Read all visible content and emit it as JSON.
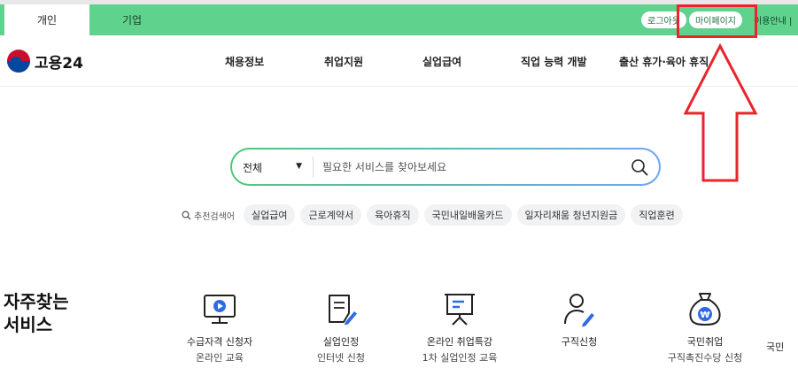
{
  "topbar": {
    "tab_personal": "개인",
    "tab_company": "기업",
    "logout": "로그아웃",
    "mypage": "마이페이지",
    "guide": "이용안내 |"
  },
  "header": {
    "logo_text": "고용24",
    "nav": [
      "채용정보",
      "취업지원",
      "실업급여",
      "직업 능력 개발",
      "출산 휴가·육아 휴직"
    ]
  },
  "search": {
    "category": "전체",
    "placeholder": "필요한 서비스를 찾아보세요"
  },
  "recommended": {
    "label": "추천검색어",
    "chips": [
      "실업급여",
      "근로계약서",
      "육아휴직",
      "국민내일배움카드",
      "일자리채움 청년지원금",
      "직업훈련"
    ]
  },
  "frequent": {
    "title_line1": "자주찾는",
    "title_line2": "서비스",
    "items": [
      {
        "line1": "수급자격 신청자",
        "line2": "온라인 교육",
        "icon": "monitor-play-icon"
      },
      {
        "line1": "실업인정",
        "line2": "인터넷 신청",
        "icon": "document-pen-icon"
      },
      {
        "line1": "온라인 취업특강",
        "line2": "1차 실업인정 교육",
        "icon": "presentation-board-icon"
      },
      {
        "line1": "구직신청",
        "line2": "",
        "icon": "person-pen-icon"
      },
      {
        "line1": "국민취업",
        "line2": "구직촉진수당 신청",
        "icon": "money-bag-won-icon"
      },
      {
        "line1": "국민",
        "line2": "",
        "icon": ""
      }
    ]
  },
  "colors": {
    "topbar_green": "#5fd38d",
    "annotation_red": "#e8242c",
    "accent_blue": "#2d6be4"
  }
}
